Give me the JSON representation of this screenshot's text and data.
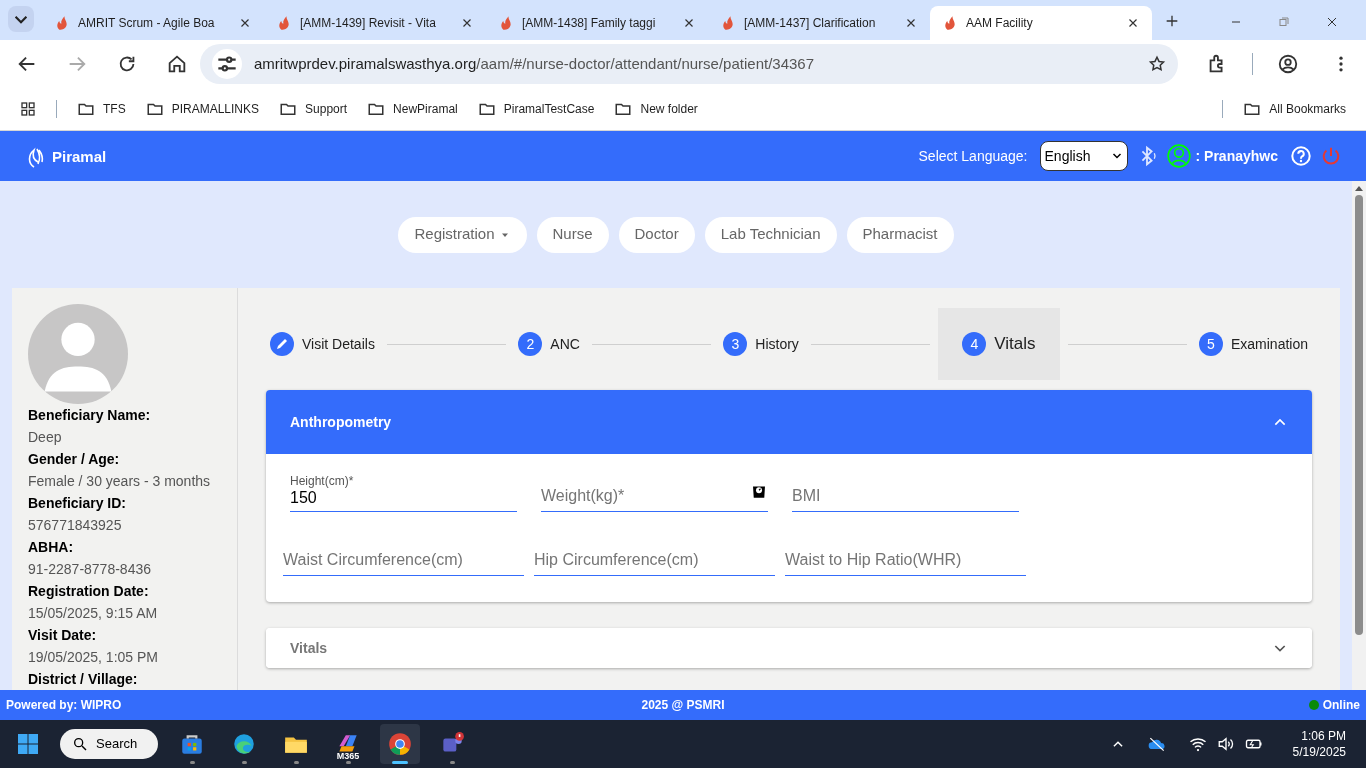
{
  "browser": {
    "tabs": [
      {
        "title": "AMRIT Scrum - Agile Boa",
        "selected": false
      },
      {
        "title": "[AMM-1439] Revisit - Vita",
        "selected": false
      },
      {
        "title": "[AMM-1438] Family taggi",
        "selected": false
      },
      {
        "title": "[AMM-1437] Clarification",
        "selected": false
      },
      {
        "title": "AAM Facility",
        "selected": true
      }
    ],
    "address": {
      "host": "amritwprdev.piramalswasthya.org",
      "path": "/aam/#/nurse-doctor/attendant/nurse/patient/34367"
    },
    "bookmarks": [
      "TFS",
      "PIRAMALLINKS",
      "Support",
      "NewPiramal",
      "PiramalTestCase",
      "New folder"
    ],
    "all_bookmarks": "All Bookmarks"
  },
  "header": {
    "brand": "Piramal",
    "language_label": "Select Language:",
    "language": "English",
    "user": ": Pranayhwc"
  },
  "roles": [
    {
      "label": "Registration",
      "has_menu": true
    },
    {
      "label": "Nurse",
      "has_menu": false
    },
    {
      "label": "Doctor",
      "has_menu": false
    },
    {
      "label": "Lab Technician",
      "has_menu": false
    },
    {
      "label": "Pharmacist",
      "has_menu": false
    }
  ],
  "patient": [
    {
      "label": "Beneficiary Name:",
      "value": "Deep"
    },
    {
      "label": "Gender / Age:",
      "value": "Female / 30 years - 3 months"
    },
    {
      "label": "Beneficiary ID:",
      "value": "576771843925"
    },
    {
      "label": "ABHA:",
      "value": "91-2287-8778-8436"
    },
    {
      "label": "Registration Date:",
      "value": "15/05/2025, 9:15 AM"
    },
    {
      "label": "Visit Date:",
      "value": "19/05/2025, 1:05 PM"
    },
    {
      "label": "District / Village:"
    }
  ],
  "steps": [
    {
      "kind": "edit",
      "label": "Visit Details",
      "selected": false
    },
    {
      "kind": "number",
      "marker": "2",
      "label": "ANC",
      "selected": false
    },
    {
      "kind": "number",
      "marker": "3",
      "label": "History",
      "selected": false
    },
    {
      "kind": "number",
      "marker": "4",
      "label": "Vitals",
      "selected": true
    },
    {
      "kind": "number",
      "marker": "5",
      "label": "Examination",
      "selected": false
    }
  ],
  "panels": [
    {
      "title": "Anthropometry",
      "expanded": true,
      "rows": [
        [
          {
            "label": "Height(cm)*",
            "value": "150",
            "scale_icon": false
          },
          {
            "label": "Weight(kg)*",
            "scale_icon": true
          },
          {
            "label": "BMI",
            "scale_icon": false
          }
        ],
        [
          {
            "label": "Waist Circumference(cm)",
            "scale_icon": false
          },
          {
            "label": "Hip Circumference(cm)",
            "scale_icon": false
          },
          {
            "label": "Waist to Hip Ratio(WHR)",
            "scale_icon": false
          }
        ]
      ]
    },
    {
      "title": "Vitals",
      "expanded": false
    }
  ],
  "footer": {
    "left": "Powered by: WIPRO",
    "center": "2025 @ PSMRI",
    "status": "Online",
    "online": true
  },
  "taskbar": {
    "search": "Search",
    "apps": [
      {
        "kind": "store",
        "selected": false
      },
      {
        "kind": "edge",
        "selected": false
      },
      {
        "kind": "files",
        "selected": false
      },
      {
        "kind": "m365",
        "label": "M365",
        "selected": false
      },
      {
        "kind": "chrome",
        "selected": true
      },
      {
        "kind": "teams",
        "selected": false
      }
    ],
    "time": "1:06 PM",
    "date": "5/19/2025"
  }
}
